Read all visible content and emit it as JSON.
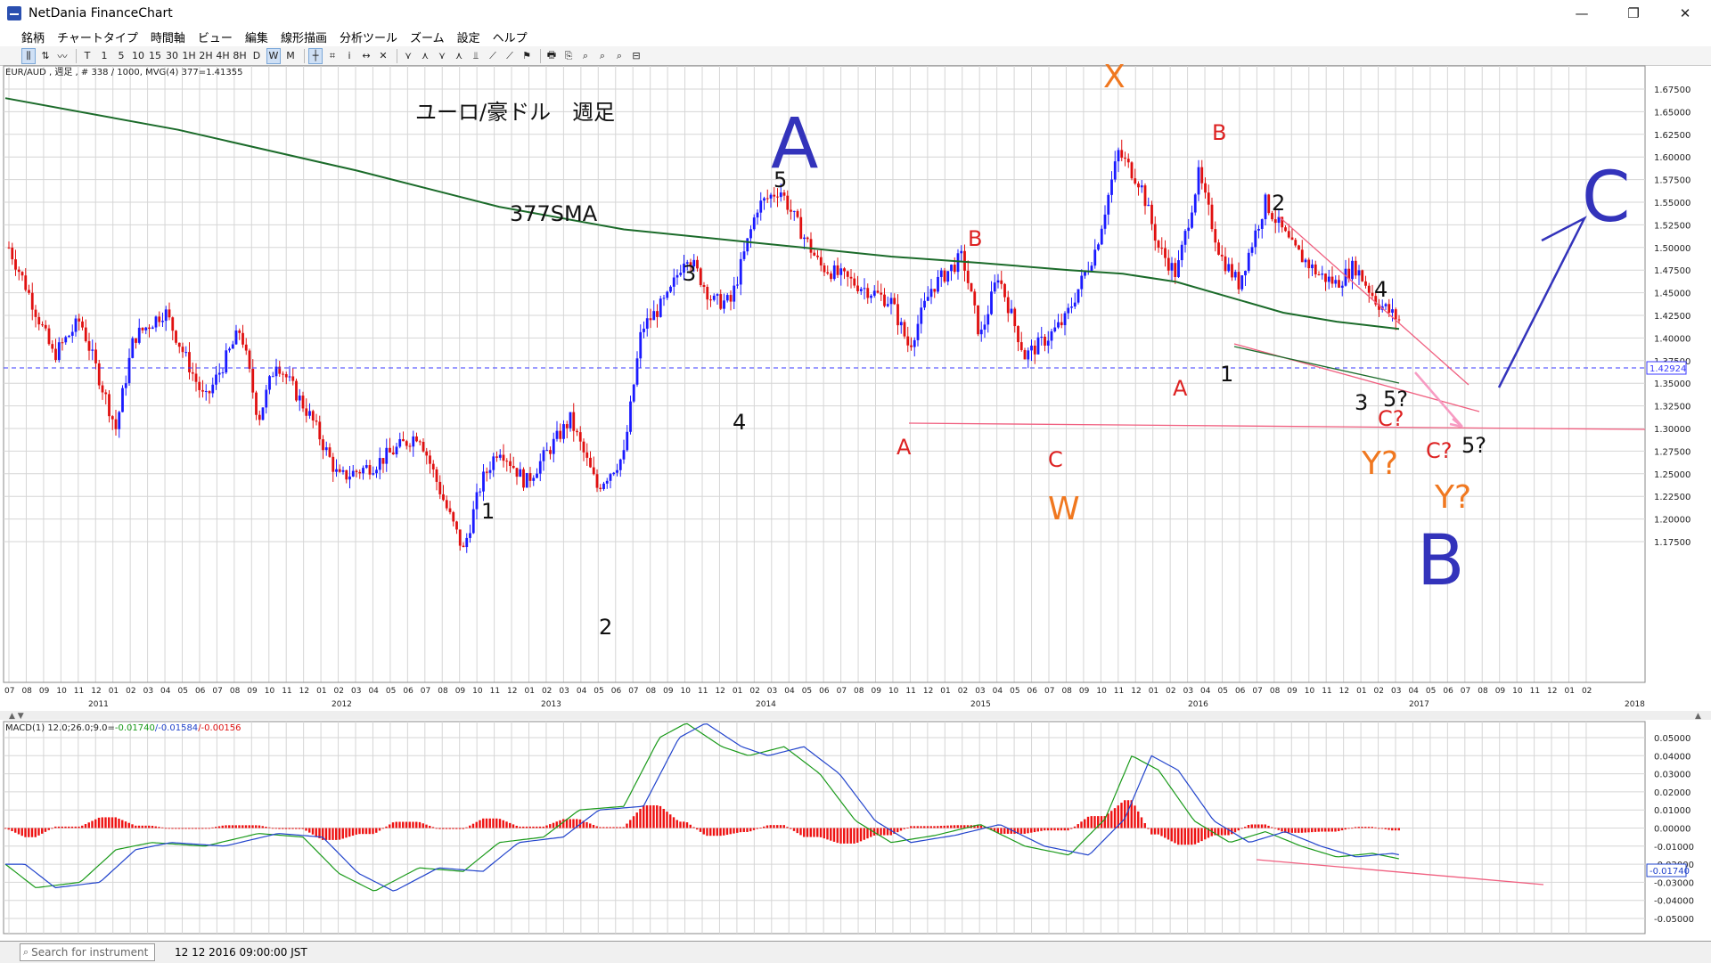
{
  "window": {
    "title": "NetDania FinanceChart",
    "minimize": "—",
    "maximize": "❐",
    "close": "✕"
  },
  "menu": [
    "銘柄",
    "チャートタイプ",
    "時間軸",
    "ビュー",
    "編集",
    "線形描画",
    "分析ツール",
    "ズーム",
    "設定",
    "ヘルプ"
  ],
  "toolbar": [
    "⫼",
    "⇅",
    "〰",
    "T",
    "1",
    "5",
    "10",
    "15",
    "30",
    "1H",
    "2H",
    "4H",
    "8H",
    "D",
    "W",
    "M",
    "┼",
    "⌗",
    "i",
    "↔",
    "✕",
    "⋎",
    "⋏",
    "⋎",
    "⋏",
    "⫫",
    "⟋",
    "⟋",
    "⚑",
    "🖶",
    "⎘",
    "⌕",
    "⌕",
    "⌕",
    "⊟"
  ],
  "chart": {
    "header": "EUR/AUD , 週足 , # 338 / 1000, MVG(4) 377=1.41355",
    "price_axis": [
      "1.67500",
      "1.65000",
      "1.62500",
      "1.60000",
      "1.57500",
      "1.55000",
      "1.52500",
      "1.50000",
      "1.47500",
      "1.45000",
      "1.42500",
      "1.40000",
      "1.37500",
      "1.35000",
      "1.32500",
      "1.30000",
      "1.27500",
      "1.25000",
      "1.22500",
      "1.20000",
      "1.17500"
    ],
    "current_price": "1.42924",
    "month_labels": [
      "07",
      "08",
      "09",
      "10",
      "11",
      "12",
      "01",
      "02",
      "03",
      "04",
      "05",
      "06",
      "07",
      "08",
      "09",
      "10",
      "11",
      "12",
      "01",
      "02",
      "03",
      "04",
      "05",
      "06",
      "07",
      "08",
      "09",
      "10",
      "11",
      "12",
      "01",
      "02",
      "03",
      "04",
      "05",
      "06",
      "07",
      "08",
      "09",
      "10",
      "11",
      "12",
      "01",
      "02",
      "03",
      "04",
      "05",
      "06",
      "07",
      "08",
      "09",
      "10",
      "11",
      "12",
      "01",
      "02",
      "03",
      "04",
      "05",
      "06",
      "07",
      "08",
      "09",
      "10",
      "11",
      "12",
      "01",
      "02",
      "03",
      "04",
      "05",
      "06",
      "07",
      "08",
      "09",
      "10",
      "11",
      "12",
      "01",
      "02",
      "03",
      "04",
      "05",
      "06",
      "07",
      "08",
      "09",
      "10",
      "11",
      "12",
      "01",
      "02"
    ],
    "year_labels": [
      "2011",
      "2012",
      "2013",
      "2014",
      "2015",
      "2016",
      "2017",
      "2018"
    ],
    "annotations": {
      "title": "ユーロ/豪ドル　週足",
      "sma_label": "377SMA",
      "big_A": "A",
      "big_B": "B",
      "big_C": "C",
      "x": "X",
      "w": "W",
      "y1": "Y?",
      "y2": "Y?",
      "wave_1": "1",
      "wave_2": "2",
      "wave_3": "3",
      "wave_4": "4",
      "wave_5": "5",
      "red_B1": "B",
      "red_A1": "A",
      "red_C1": "C",
      "red_A2": "A",
      "red_B2": "B",
      "w2_1": "1",
      "w2_2": "2",
      "w2_3": "3",
      "w2_4": "4",
      "w2_5": "5?",
      "red_C2": "C?",
      "red_C3": "C?",
      "five2": "5?"
    },
    "colors": {
      "up": "#1a1aff",
      "down": "#e01010",
      "sma": "#1b6b2a",
      "wave_blue": "#3333bb",
      "wave_red": "#dd2222",
      "wave_orange": "#f07820",
      "pink": "#f06080"
    }
  },
  "macd": {
    "header_prefix": "MACD(1) 12.0;26.0;9.0=",
    "v1": "-0.01740",
    "v2": "/-0.01584",
    "v3": "/-0.00156",
    "axis": [
      "0.05000",
      "0.04000",
      "0.03000",
      "0.02000",
      "0.01000",
      "0.00000",
      "-0.01000",
      "-0.02000",
      "-0.03000",
      "-0.04000",
      "-0.05000"
    ],
    "current": "-0.01740"
  },
  "status": {
    "search_placeholder": "Search for instrument",
    "datetime": "12 12 2016 09:00:00 JST"
  }
}
